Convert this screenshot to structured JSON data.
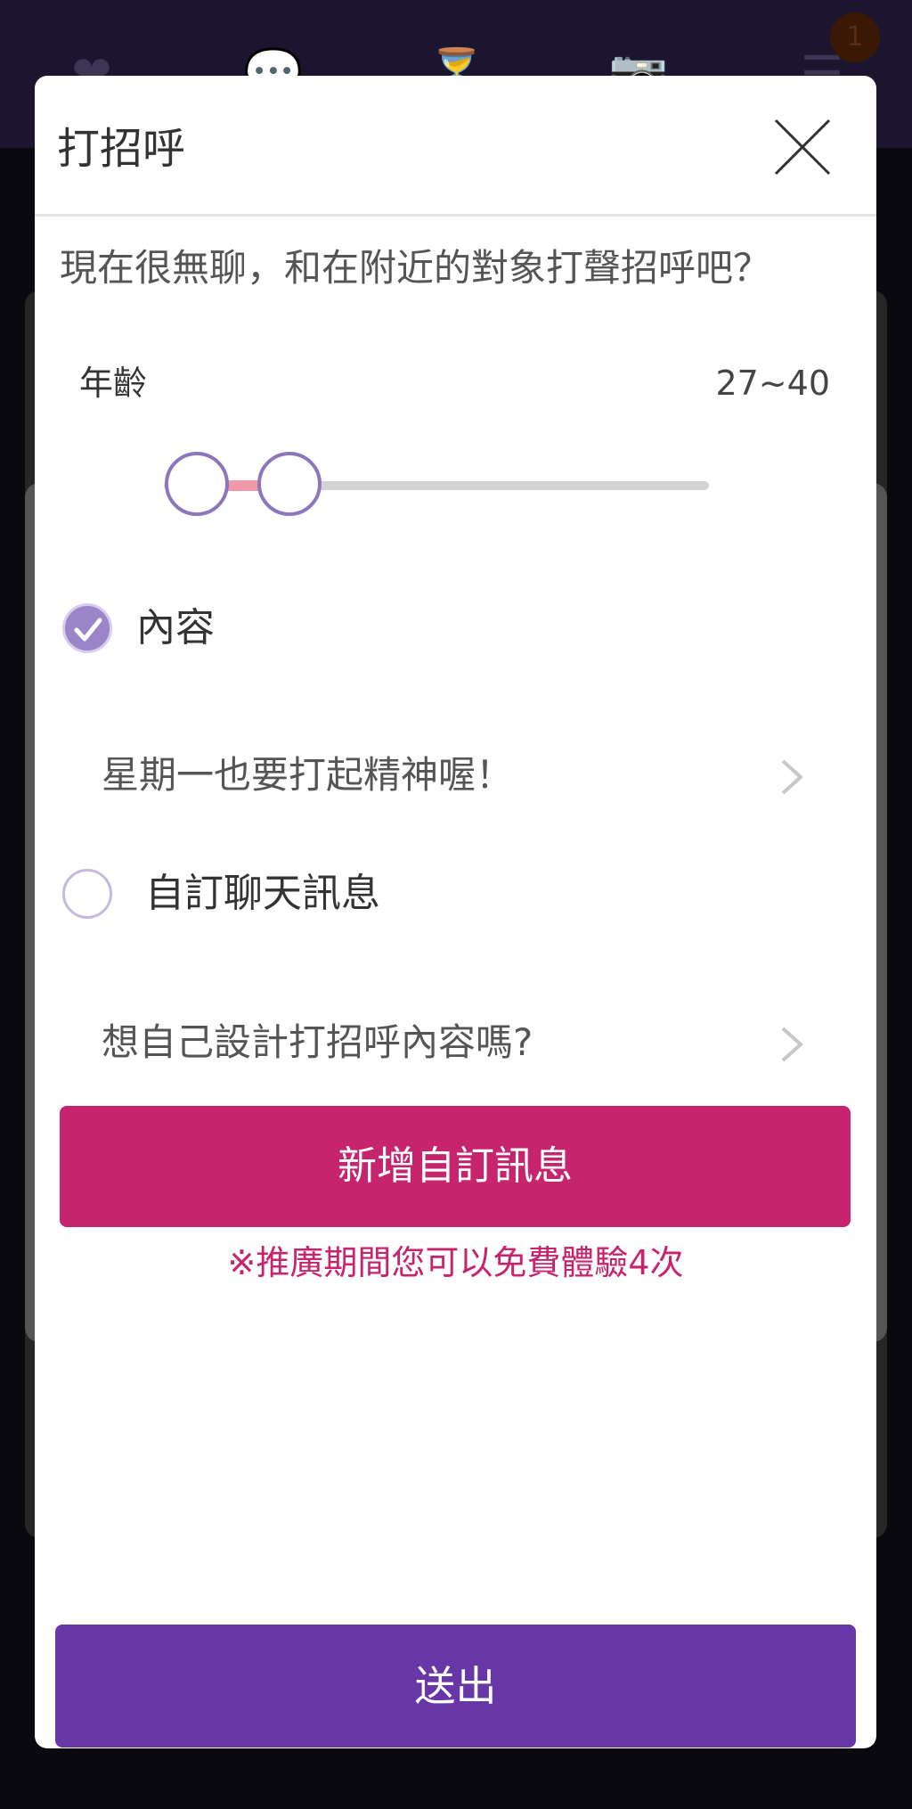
{
  "background": {
    "notification_count": "1"
  },
  "modal": {
    "title": "打招呼",
    "subtitle": "現在很無聊，和在附近的對象打聲招呼吧？",
    "age": {
      "label": "年齡",
      "value": "27~40",
      "slider_min_fraction": 0.06,
      "slider_max_fraction": 0.23
    },
    "option_content": {
      "label": "內容",
      "checked": true,
      "message": "星期一也要打起精神喔！"
    },
    "option_custom": {
      "label": "自訂聊天訊息",
      "checked": false,
      "message": "想自己設計打招呼內容嗎?"
    },
    "add_button_label": "新增自訂訊息",
    "promo_text": "※推廣期間您可以免費體驗4次",
    "send_button_label": "送出"
  },
  "colors": {
    "accent_pink": "#c6246c",
    "accent_purple": "#6737a8",
    "thumb_border": "#8c76bd",
    "range_fill": "#f09aa7"
  }
}
